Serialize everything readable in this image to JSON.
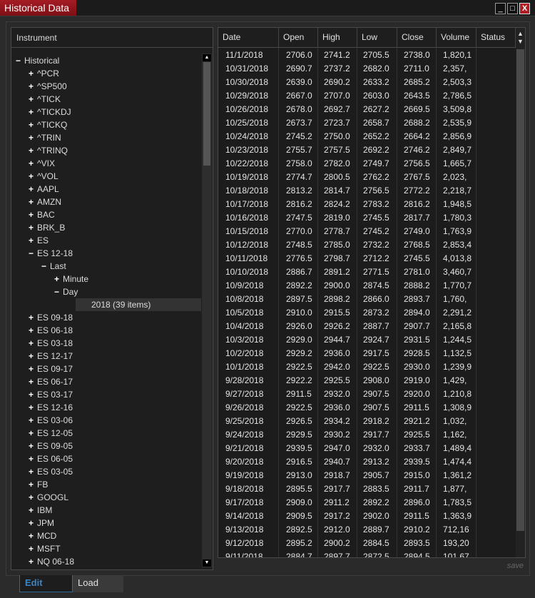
{
  "window": {
    "title": "Historical Data",
    "minimize": "_",
    "maximize": "□",
    "close": "X"
  },
  "tree": {
    "header": "Instrument",
    "nodes": [
      {
        "label": "Historical",
        "level": 0,
        "toggle": "−"
      },
      {
        "label": "^PCR",
        "level": 1,
        "toggle": "+"
      },
      {
        "label": "^SP500",
        "level": 1,
        "toggle": "+"
      },
      {
        "label": "^TICK",
        "level": 1,
        "toggle": "+"
      },
      {
        "label": "^TICKDJ",
        "level": 1,
        "toggle": "+"
      },
      {
        "label": "^TICKQ",
        "level": 1,
        "toggle": "+"
      },
      {
        "label": "^TRIN",
        "level": 1,
        "toggle": "+"
      },
      {
        "label": "^TRINQ",
        "level": 1,
        "toggle": "+"
      },
      {
        "label": "^VIX",
        "level": 1,
        "toggle": "+"
      },
      {
        "label": "^VOL",
        "level": 1,
        "toggle": "+"
      },
      {
        "label": "AAPL",
        "level": 1,
        "toggle": "+"
      },
      {
        "label": "AMZN",
        "level": 1,
        "toggle": "+"
      },
      {
        "label": "BAC",
        "level": 1,
        "toggle": "+"
      },
      {
        "label": "BRK_B",
        "level": 1,
        "toggle": "+"
      },
      {
        "label": "ES",
        "level": 1,
        "toggle": "+"
      },
      {
        "label": "ES 12-18",
        "level": 1,
        "toggle": "−"
      },
      {
        "label": "Last",
        "level": 2,
        "toggle": "−"
      },
      {
        "label": "Minute",
        "level": 3,
        "toggle": "+"
      },
      {
        "label": "Day",
        "level": 3,
        "toggle": "−"
      },
      {
        "label": "2018 (39 items)",
        "level": 4,
        "toggle": "",
        "selected": true
      },
      {
        "label": "ES 09-18",
        "level": 1,
        "toggle": "+"
      },
      {
        "label": "ES 06-18",
        "level": 1,
        "toggle": "+"
      },
      {
        "label": "ES 03-18",
        "level": 1,
        "toggle": "+"
      },
      {
        "label": "ES 12-17",
        "level": 1,
        "toggle": "+"
      },
      {
        "label": "ES 09-17",
        "level": 1,
        "toggle": "+"
      },
      {
        "label": "ES 06-17",
        "level": 1,
        "toggle": "+"
      },
      {
        "label": "ES 03-17",
        "level": 1,
        "toggle": "+"
      },
      {
        "label": "ES 12-16",
        "level": 1,
        "toggle": "+"
      },
      {
        "label": "ES 03-06",
        "level": 1,
        "toggle": "+"
      },
      {
        "label": "ES 12-05",
        "level": 1,
        "toggle": "+"
      },
      {
        "label": "ES 09-05",
        "level": 1,
        "toggle": "+"
      },
      {
        "label": "ES 06-05",
        "level": 1,
        "toggle": "+"
      },
      {
        "label": "ES 03-05",
        "level": 1,
        "toggle": "+"
      },
      {
        "label": "FB",
        "level": 1,
        "toggle": "+"
      },
      {
        "label": "GOOGL",
        "level": 1,
        "toggle": "+"
      },
      {
        "label": "IBM",
        "level": 1,
        "toggle": "+"
      },
      {
        "label": "JPM",
        "level": 1,
        "toggle": "+"
      },
      {
        "label": "MCD",
        "level": 1,
        "toggle": "+"
      },
      {
        "label": "MSFT",
        "level": 1,
        "toggle": "+"
      },
      {
        "label": "NQ 06-18",
        "level": 1,
        "toggle": "+"
      }
    ]
  },
  "grid": {
    "columns": [
      "Date",
      "Open",
      "High",
      "Low",
      "Close",
      "Volume",
      "Status"
    ],
    "rows": [
      [
        "11/1/2018",
        "2706.0",
        "2741.2",
        "2705.5",
        "2738.0",
        "1,820,1",
        ""
      ],
      [
        "10/31/2018",
        "2690.7",
        "2737.2",
        "2682.0",
        "2711.0",
        "2,357,",
        ""
      ],
      [
        "10/30/2018",
        "2639.0",
        "2690.2",
        "2633.2",
        "2685.2",
        "2,503,3",
        ""
      ],
      [
        "10/29/2018",
        "2667.0",
        "2707.0",
        "2603.0",
        "2643.5",
        "2,786,5",
        ""
      ],
      [
        "10/26/2018",
        "2678.0",
        "2692.7",
        "2627.2",
        "2669.5",
        "3,509,8",
        ""
      ],
      [
        "10/25/2018",
        "2673.7",
        "2723.7",
        "2658.7",
        "2688.2",
        "2,535,9",
        ""
      ],
      [
        "10/24/2018",
        "2745.2",
        "2750.0",
        "2652.2",
        "2664.2",
        "2,856,9",
        ""
      ],
      [
        "10/23/2018",
        "2755.7",
        "2757.5",
        "2692.2",
        "2746.2",
        "2,849,7",
        ""
      ],
      [
        "10/22/2018",
        "2758.0",
        "2782.0",
        "2749.7",
        "2756.5",
        "1,665,7",
        ""
      ],
      [
        "10/19/2018",
        "2774.7",
        "2800.5",
        "2762.2",
        "2767.5",
        "2,023,",
        ""
      ],
      [
        "10/18/2018",
        "2813.2",
        "2814.7",
        "2756.5",
        "2772.2",
        "2,218,7",
        ""
      ],
      [
        "10/17/2018",
        "2816.2",
        "2824.2",
        "2783.2",
        "2816.2",
        "1,948,5",
        ""
      ],
      [
        "10/16/2018",
        "2747.5",
        "2819.0",
        "2745.5",
        "2817.7",
        "1,780,3",
        ""
      ],
      [
        "10/15/2018",
        "2770.0",
        "2778.7",
        "2745.2",
        "2749.0",
        "1,763,9",
        ""
      ],
      [
        "10/12/2018",
        "2748.5",
        "2785.0",
        "2732.2",
        "2768.5",
        "2,853,4",
        ""
      ],
      [
        "10/11/2018",
        "2776.5",
        "2798.7",
        "2712.2",
        "2745.5",
        "4,013,8",
        ""
      ],
      [
        "10/10/2018",
        "2886.7",
        "2891.2",
        "2771.5",
        "2781.0",
        "3,460,7",
        ""
      ],
      [
        "10/9/2018",
        "2892.2",
        "2900.0",
        "2874.5",
        "2888.2",
        "1,770,7",
        ""
      ],
      [
        "10/8/2018",
        "2897.5",
        "2898.2",
        "2866.0",
        "2893.7",
        "1,760,",
        ""
      ],
      [
        "10/5/2018",
        "2910.0",
        "2915.5",
        "2873.2",
        "2894.0",
        "2,291,2",
        ""
      ],
      [
        "10/4/2018",
        "2926.0",
        "2926.2",
        "2887.7",
        "2907.7",
        "2,165,8",
        ""
      ],
      [
        "10/3/2018",
        "2929.0",
        "2944.7",
        "2924.7",
        "2931.5",
        "1,244,5",
        ""
      ],
      [
        "10/2/2018",
        "2929.2",
        "2936.0",
        "2917.5",
        "2928.5",
        "1,132,5",
        ""
      ],
      [
        "10/1/2018",
        "2922.5",
        "2942.0",
        "2922.5",
        "2930.0",
        "1,239,9",
        ""
      ],
      [
        "9/28/2018",
        "2922.2",
        "2925.5",
        "2908.0",
        "2919.0",
        "1,429,",
        ""
      ],
      [
        "9/27/2018",
        "2911.5",
        "2932.0",
        "2907.5",
        "2920.0",
        "1,210,8",
        ""
      ],
      [
        "9/26/2018",
        "2922.5",
        "2936.0",
        "2907.5",
        "2911.5",
        "1,308,9",
        ""
      ],
      [
        "9/25/2018",
        "2926.5",
        "2934.2",
        "2918.2",
        "2921.2",
        "1,032,",
        ""
      ],
      [
        "9/24/2018",
        "2929.5",
        "2930.2",
        "2917.7",
        "2925.5",
        "1,162,",
        ""
      ],
      [
        "9/21/2018",
        "2939.5",
        "2947.0",
        "2932.0",
        "2933.7",
        "1,489,4",
        ""
      ],
      [
        "9/20/2018",
        "2916.5",
        "2940.7",
        "2913.2",
        "2939.5",
        "1,474,4",
        ""
      ],
      [
        "9/19/2018",
        "2913.0",
        "2918.7",
        "2905.7",
        "2915.0",
        "1,361,2",
        ""
      ],
      [
        "9/18/2018",
        "2895.5",
        "2917.7",
        "2883.5",
        "2911.7",
        "1,877,",
        ""
      ],
      [
        "9/17/2018",
        "2909.0",
        "2911.2",
        "2892.2",
        "2896.0",
        "1,783,5",
        ""
      ],
      [
        "9/14/2018",
        "2909.5",
        "2917.2",
        "2902.0",
        "2911.5",
        "1,363,9",
        ""
      ],
      [
        "9/13/2018",
        "2892.5",
        "2912.0",
        "2889.7",
        "2910.2",
        "712,16",
        ""
      ],
      [
        "9/12/2018",
        "2895.2",
        "2900.2",
        "2884.5",
        "2893.5",
        "193,20",
        ""
      ],
      [
        "9/11/2018",
        "2884.7",
        "2897.7",
        "2872.5",
        "2894.5",
        "101,67",
        ""
      ]
    ]
  },
  "footer": {
    "save": "save",
    "tabs": [
      {
        "label": "Edit",
        "active": true
      },
      {
        "label": "Load",
        "active": false
      }
    ]
  },
  "colors": {
    "title_accent": "#a51c24",
    "active_tab": "#3a85c4"
  }
}
